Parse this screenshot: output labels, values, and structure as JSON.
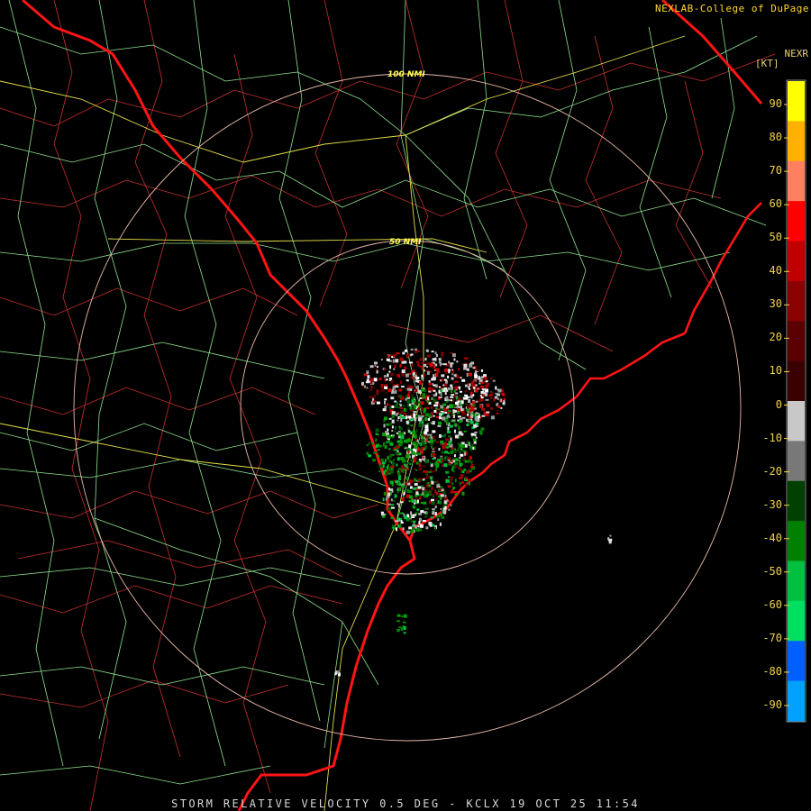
{
  "credit": "NEXLAB-College of DuPage",
  "product": "NEXR",
  "unit": "[KT]",
  "caption": "STORM RELATIVE VELOCITY 0.5 DEG - KCLX 19 OCT 25 11:54",
  "range_rings": [
    {
      "label": "50 NMI"
    },
    {
      "label": "100 NMI"
    }
  ],
  "color_scale": {
    "labels": [
      "90",
      "80",
      "70",
      "60",
      "50",
      "40",
      "30",
      "20",
      "10",
      "0",
      "-10",
      "-20",
      "-30",
      "-40",
      "-50",
      "-60",
      "-70",
      "-80",
      "-90"
    ],
    "colors": [
      "#ffff00",
      "#ffb000",
      "#ff7f60",
      "#ff0000",
      "#c00000",
      "#8b0000",
      "#5a0000",
      "#3a0000",
      "#c8c8c8",
      "#787878",
      "#004000",
      "#008000",
      "#00c040",
      "#00e060",
      "#0060ff",
      "#00a0ff"
    ]
  }
}
